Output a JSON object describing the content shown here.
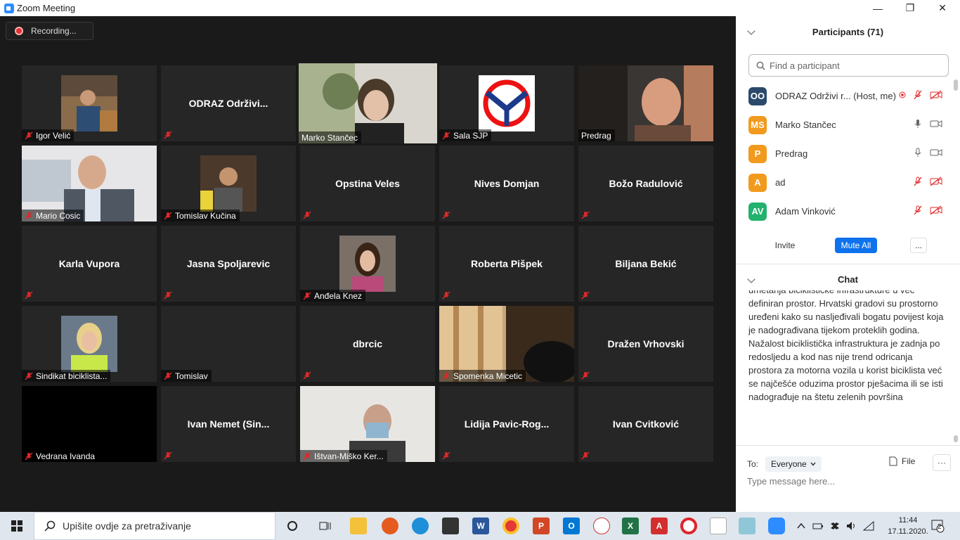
{
  "window": {
    "title": "Zoom Meeting",
    "controls": [
      "—",
      "❐",
      "✕"
    ]
  },
  "recording": {
    "label": "Recording..."
  },
  "tiles": [
    {
      "name": "Igor Velić",
      "center": ""
    },
    {
      "name": "",
      "center": "ODRAZ  Održivi..."
    },
    {
      "name": "Marko Stančec",
      "center": ""
    },
    {
      "name": "Sala SJP",
      "center": ""
    },
    {
      "name": "Predrag",
      "center": ""
    },
    {
      "name": "Mario Cosic",
      "center": ""
    },
    {
      "name": "Tomislav Kučina",
      "center": ""
    },
    {
      "name": "",
      "center": "Opstina Veles"
    },
    {
      "name": "",
      "center": "Nives Domjan"
    },
    {
      "name": "",
      "center": "Božo Radulović"
    },
    {
      "name": "",
      "center": "Karla Vupora"
    },
    {
      "name": "",
      "center": "Jasna Spoljarevic"
    },
    {
      "name": "Anđela Knez",
      "center": ""
    },
    {
      "name": "",
      "center": "Roberta Pišpek"
    },
    {
      "name": "",
      "center": "Biljana Bekić"
    },
    {
      "name": "Sindikat biciklista...",
      "center": ""
    },
    {
      "name": "Tomislav",
      "center": ""
    },
    {
      "name": "",
      "center": "dbrcic"
    },
    {
      "name": "Spomenka Micetic",
      "center": ""
    },
    {
      "name": "",
      "center": "Dražen Vrhovski"
    },
    {
      "name": "Vedrana Ivanda",
      "center": ""
    },
    {
      "name": "",
      "center": "Ivan  Nemet  (Sin..."
    },
    {
      "name": "Ištvan-Miško Ker...",
      "center": ""
    },
    {
      "name": "",
      "center": "Lidija  Pavic-Rog..."
    },
    {
      "name": "",
      "center": "Ivan Cvitković"
    }
  ],
  "participants": {
    "title": "Participants (71)",
    "search_placeholder": "Find a participant",
    "list": [
      {
        "initials": "OO",
        "name": "ODRAZ Održivi r...  (Host, me)",
        "color": "#2b4a6b"
      },
      {
        "initials": "MS",
        "name": "Marko Stančec",
        "color": "#f29a1d"
      },
      {
        "initials": "P",
        "name": "Predrag",
        "color": "#f29a1d"
      },
      {
        "initials": "A",
        "name": "ad",
        "color": "#f29a1d"
      },
      {
        "initials": "AV",
        "name": "Adam Vinković",
        "color": "#23b26d"
      }
    ],
    "buttons": {
      "invite": "Invite",
      "mute_all": "Mute All",
      "more": "..."
    }
  },
  "chat": {
    "title": "Chat",
    "message": "umetanja biciklističke infrastrukture u već definiran prostor. Hrvatski gradovi su prostorno uređeni kako su nasljeđivali bogatu povijest koja je nadograđivana tijekom proteklih godina. Nažalost biciklistička infrastruktura je zadnja po redosljedu a kod nas nije trend odricanja prostora za motorna vozila u korist biciklista već se najčešće oduzima prostor pješacima ili se isti nadograđuje na štetu zelenih površina",
    "to_label": "To:",
    "to_value": "Everyone",
    "file_label": "File",
    "more": "···",
    "input_placeholder": "Type message here..."
  },
  "taskbar": {
    "search_placeholder": "Upišite ovdje za pretraživanje",
    "time": "11:44",
    "date": "17.11.2020.",
    "notifications": "2"
  },
  "colors": {
    "accent": "#0e72ed",
    "active_speaker": "#e8e56c",
    "mute_red": "#e02828"
  }
}
